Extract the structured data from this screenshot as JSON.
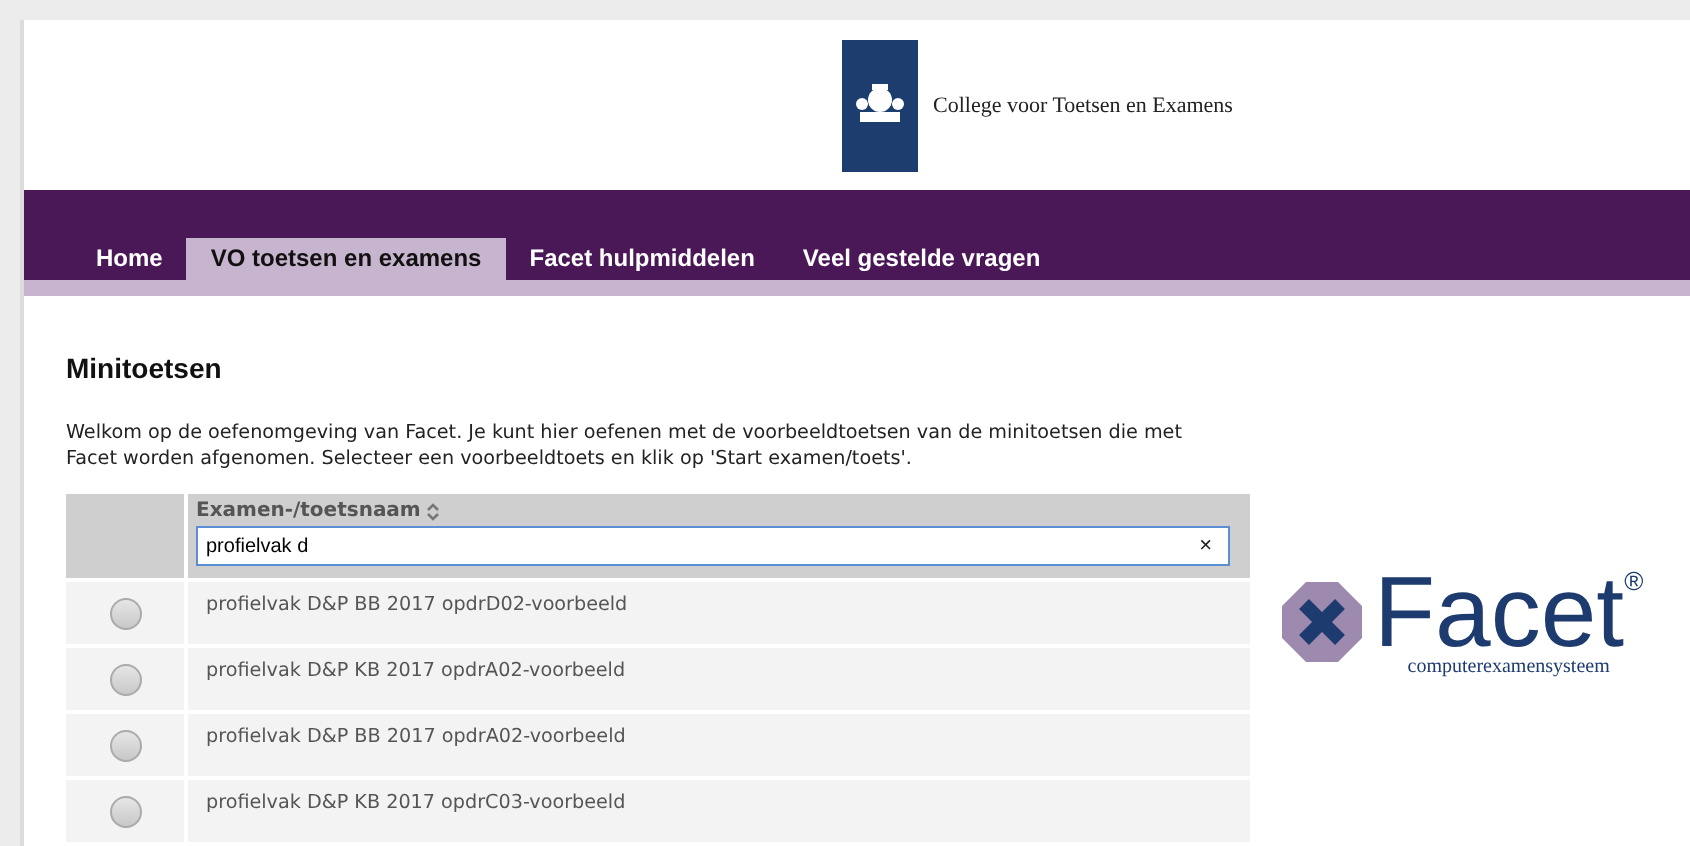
{
  "header": {
    "organisation": "College voor Toetsen en Examens"
  },
  "nav": [
    {
      "label": "Home",
      "selected": false
    },
    {
      "label": "VO toetsen en examens",
      "selected": true
    },
    {
      "label": "Facet hulpmiddelen",
      "selected": false
    },
    {
      "label": "Veel gestelde vragen",
      "selected": false
    }
  ],
  "page": {
    "title": "Minitoetsen",
    "intro": "Welkom op de oefenomgeving van Facet. Je kunt hier oefenen met de voorbeeldtoetsen van de minitoetsen die met Facet worden afgenomen. Selecteer een voorbeeldtoets en klik op 'Start examen/toets'."
  },
  "logo": {
    "name": "Facet",
    "mark": "®",
    "tagline": "computerexamensysteem"
  },
  "table": {
    "column": "Examen-/toetsnaam",
    "filter": {
      "value": "profielvak d",
      "clear": "×"
    },
    "rows": [
      {
        "name": "profielvak D&P BB 2017 opdrD02-voorbeeld",
        "selected": false
      },
      {
        "name": "profielvak D&P KB 2017 opdrA02-voorbeeld",
        "selected": false
      },
      {
        "name": "profielvak D&P BB 2017 opdrA02-voorbeeld",
        "selected": false
      },
      {
        "name": "profielvak D&P KB 2017 opdrC03-voorbeeld",
        "selected": false
      }
    ]
  }
}
